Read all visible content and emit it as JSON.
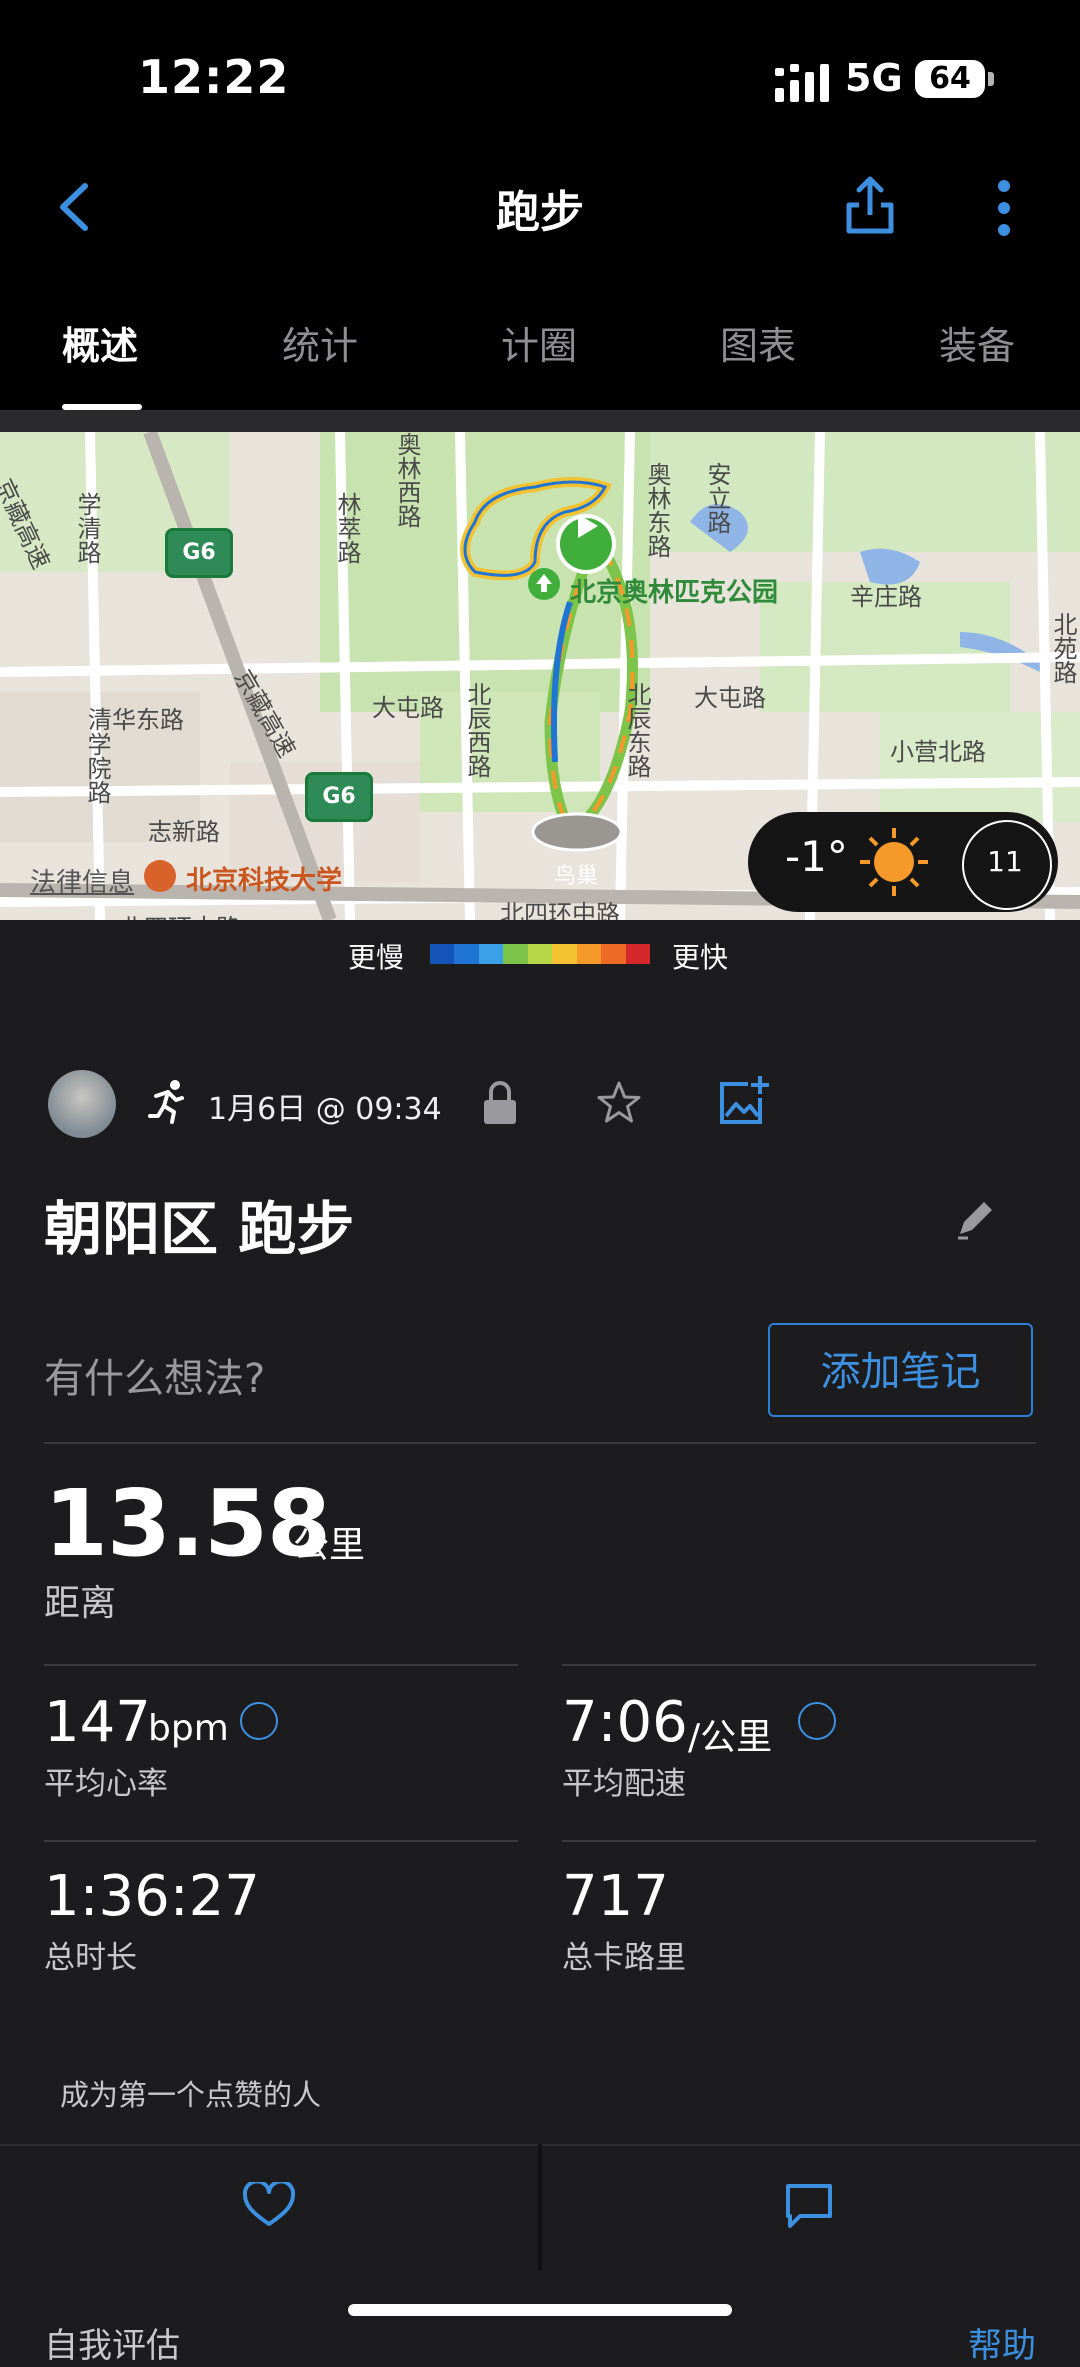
{
  "status": {
    "time": "12:22",
    "network": "5G",
    "battery": "64"
  },
  "nav": {
    "title": "跑步"
  },
  "tabs": [
    {
      "label": "概述"
    },
    {
      "label": "统计"
    },
    {
      "label": "计圈"
    },
    {
      "label": "图表"
    },
    {
      "label": "装备"
    }
  ],
  "map": {
    "labels": [
      "学清路",
      "林萃路",
      "安立路",
      "辛庄路",
      "清华东路",
      "大屯路",
      "大屯路",
      "小营北路",
      "学院路",
      "志新路",
      "北四环中路",
      "北辰西路",
      "北辰东路",
      "京藏高速",
      "京藏高速",
      "北苑路",
      "奥林西路",
      "奥林东路",
      "鸟巢",
      "北四环中路"
    ],
    "park": "北京奥林匹克公园",
    "university": "北京科技大学",
    "highway": "G6",
    "legal": "法律信息",
    "weather": {
      "temp": "-1°",
      "wind": "11"
    }
  },
  "legend": {
    "slower": "更慢",
    "faster": "更快",
    "colors": [
      "#1554b8",
      "#1f74d4",
      "#3aa0e8",
      "#7cc44a",
      "#b8d84a",
      "#f2c230",
      "#f59a2a",
      "#ec6a24",
      "#d6272b"
    ]
  },
  "activity": {
    "date": "1月6日 @ 09:34",
    "title": "朝阳区 跑步",
    "note_placeholder": "有什么想法?",
    "add_note": "添加笔记",
    "distance": {
      "value": "13.58",
      "unit": "公里",
      "label": "距离"
    },
    "stats": [
      {
        "value": "147",
        "unit": "bpm",
        "label": "平均心率"
      },
      {
        "value": "7:06",
        "unit": "/公里",
        "label": "平均配速"
      },
      {
        "value": "1:36:27",
        "unit": "",
        "label": "总时长"
      },
      {
        "value": "717",
        "unit": "",
        "label": "总卡路里"
      }
    ],
    "likes_text": "成为第一个点赞的人",
    "self_eval": "自我评估",
    "help": "帮助"
  }
}
